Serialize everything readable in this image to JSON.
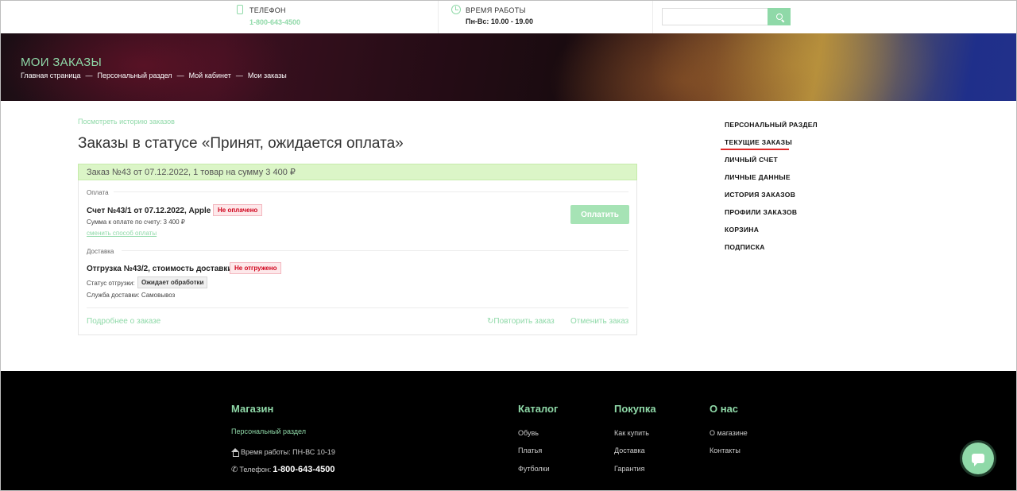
{
  "topbar": {
    "phone_label": "ТЕЛЕФОН",
    "phone_number": "1-800-643-4500",
    "hours_label": "ВРЕМЯ РАБОТЫ",
    "hours_value": "Пн-Вс: 10.00 - 19.00",
    "search_placeholder": ""
  },
  "banner": {
    "title": "МОИ ЗАКАЗЫ",
    "breadcrumbs": [
      "Главная страница",
      "Персональный раздел",
      "Мой кабинет",
      "Мои заказы"
    ],
    "separator": "—"
  },
  "main": {
    "history_link": "Посмотреть историю заказов",
    "title": "Заказы в статусе «Принят, ожидается оплата»",
    "order": {
      "header": "Заказ №43 от 07.12.2022, 1 товар на сумму 3 400 ₽",
      "payment_section": "Оплата",
      "invoice_title": "Счет №43/1 от 07.12.2022, Apple Pay",
      "invoice_status": "Не оплачено",
      "amount_text": "Сумма к оплате по счету: 3 400 ₽",
      "change_payment": "сменить способ оплаты",
      "pay_button": "Оплатить",
      "delivery_section": "Доставка",
      "shipment_title": "Отгрузка №43/2, стоимость доставки 0 ₽",
      "shipment_status": "Не отгружено",
      "shipment_status_label": "Статус отгрузки:",
      "shipment_processing": "Ожидает обработки",
      "delivery_service": "Служба доставки: Самовывоз",
      "details_link": "Подробнее о заказе",
      "repeat_link": "Повторить заказ",
      "cancel_link": "Отменить заказ"
    }
  },
  "sidenav": {
    "items": [
      "ПЕРСОНАЛЬНЫЙ РАЗДЕЛ",
      "ТЕКУЩИЕ ЗАКАЗЫ",
      "ЛИЧНЫЙ СЧЕТ",
      "ЛИЧНЫЕ ДАННЫЕ",
      "ИСТОРИЯ ЗАКАЗОВ",
      "ПРОФИЛИ ЗАКАЗОВ",
      "КОРЗИНА",
      "ПОДПИСКА"
    ],
    "active_index": 1
  },
  "footer": {
    "shop_heading": "Магазин",
    "personal_link": "Персональный раздел",
    "hours": "Время работы: ПН-ВС 10-19",
    "phone_label": "Телефон:",
    "phone": "1-800-643-4500",
    "catalog_heading": "Каталог",
    "catalog_links": [
      "Обувь",
      "Платья",
      "Футболки"
    ],
    "buy_heading": "Покупка",
    "buy_links": [
      "Как купить",
      "Доставка",
      "Гарантия"
    ],
    "about_heading": "О нас",
    "about_links": [
      "О магазине",
      "Контакты"
    ]
  },
  "colors": {
    "accent": "#8fd9a8",
    "order_header_bg": "#dbf5c7",
    "active_underline": "#e02b2b",
    "footer_bg": "#000000"
  }
}
